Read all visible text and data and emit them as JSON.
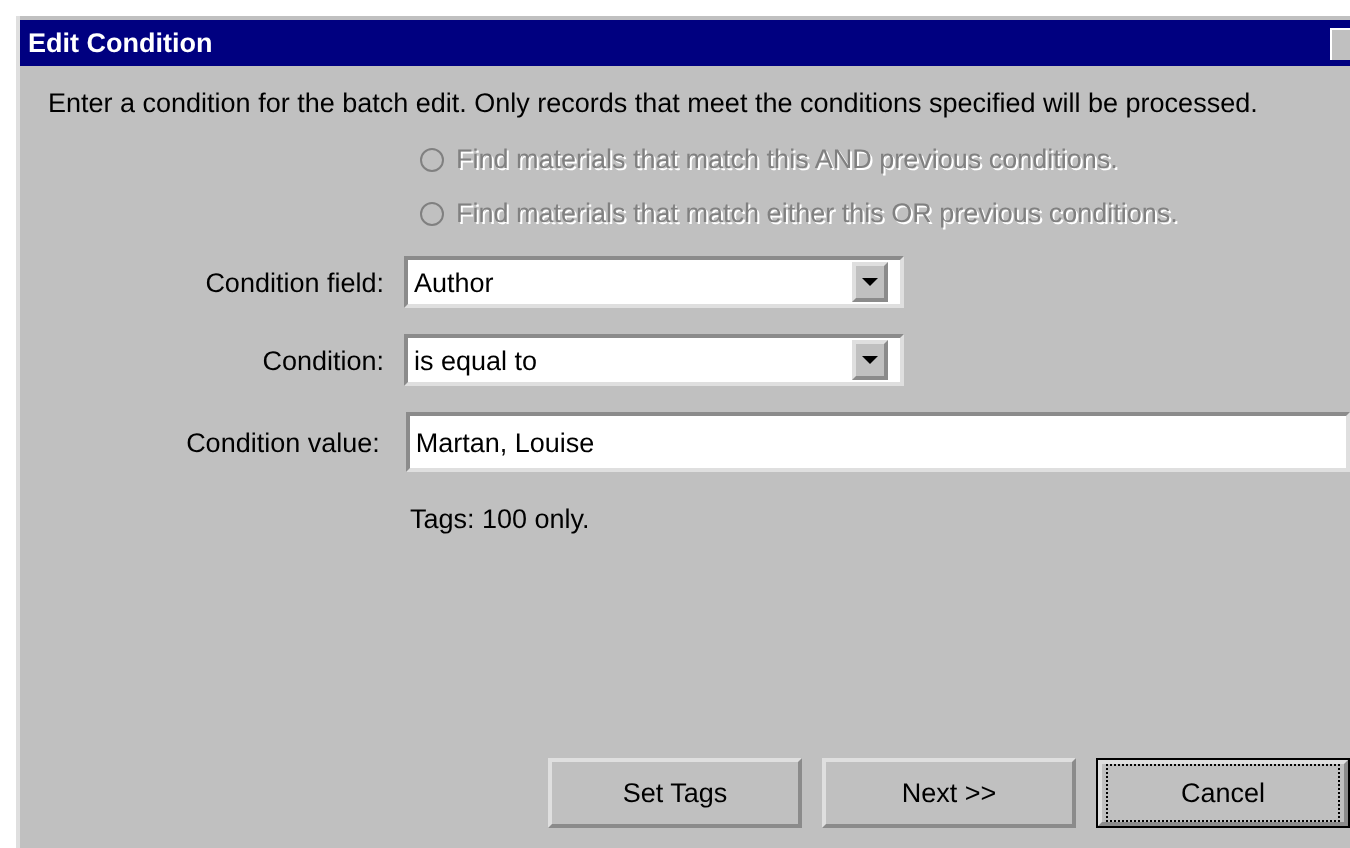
{
  "window": {
    "title": "Edit Condition"
  },
  "instructions": "Enter a condition for the batch edit.  Only records that meet the conditions specified will be processed.",
  "options": [
    {
      "label": "Find materials that match this AND previous conditions.",
      "selected": false,
      "disabled": true
    },
    {
      "label": "Find materials that match either this OR previous conditions.",
      "selected": false,
      "disabled": true
    }
  ],
  "fields": [
    {
      "kind": "dropdown",
      "label": "Condition field:",
      "value": "Author"
    },
    {
      "kind": "dropdown",
      "label": "Condition:",
      "value": "is equal to"
    },
    {
      "kind": "text",
      "label": "Condition value:",
      "value": "Martan, Louise"
    }
  ],
  "note": "Tags: 100 only.",
  "buttons": [
    {
      "label": "Set Tags",
      "default": false
    },
    {
      "label": "Next >>",
      "default": false
    },
    {
      "label": "Cancel",
      "default": true
    }
  ]
}
